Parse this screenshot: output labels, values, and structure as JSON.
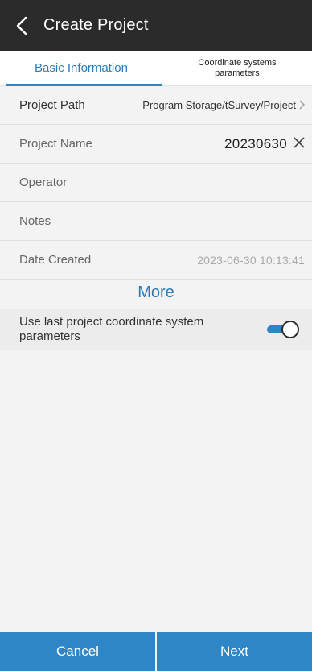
{
  "header": {
    "title": "Create Project",
    "back_icon": "chevron-left-icon"
  },
  "tabs": [
    {
      "label": "Basic Information",
      "active": true
    },
    {
      "label": "Coordinate systems parameters",
      "active": false
    }
  ],
  "form": {
    "project_path": {
      "label": "Project Path",
      "value": "Program Storage/tSurvey/Project"
    },
    "project_name": {
      "label": "Project Name",
      "value": "20230630"
    },
    "operator": {
      "label": "Operator",
      "value": ""
    },
    "notes": {
      "label": "Notes",
      "value": ""
    },
    "date_created": {
      "label": "Date Created",
      "value": "2023-06-30 10:13:41"
    }
  },
  "more_label": "More",
  "use_last_params": {
    "label": "Use last project coordinate system parameters",
    "enabled": true
  },
  "footer": {
    "cancel_label": "Cancel",
    "next_label": "Next"
  },
  "colors": {
    "accent": "#2f86c7",
    "header_bg": "#2b2b2b",
    "background": "#f3f3f3"
  }
}
